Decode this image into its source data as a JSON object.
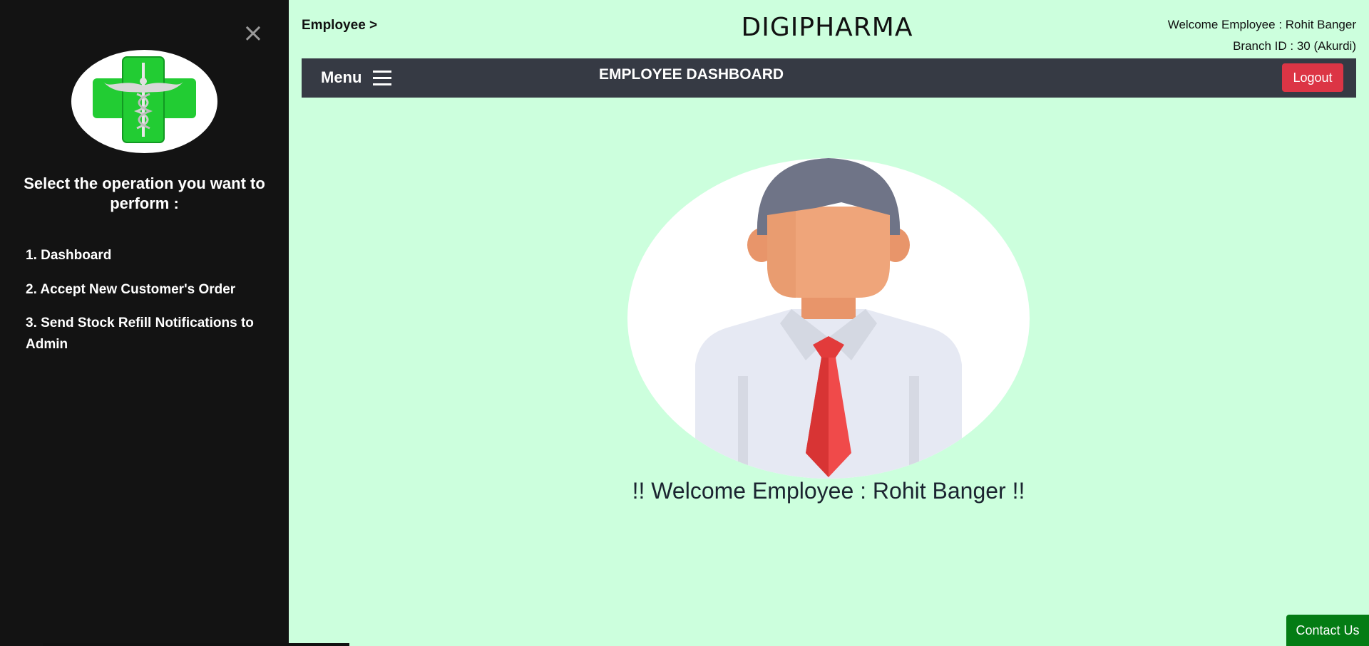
{
  "sidebar": {
    "close_icon": "×",
    "prompt": "Select the operation you want to perform :",
    "operations": [
      "1. Dashboard",
      "2. Accept New Customer's Order",
      "3. Send Stock Refill Notifications to Admin"
    ]
  },
  "header": {
    "breadcrumb": "Employee >",
    "brand": "DIGIPHARMA",
    "welcome": "Welcome Employee : Rohit Banger",
    "branch": "Branch ID : 30 (Akurdi)"
  },
  "navbar": {
    "menu_label": "Menu",
    "title": "EMPLOYEE DASHBOARD",
    "logout_label": "Logout"
  },
  "main": {
    "welcome_message": "!! Welcome Employee : Rohit Banger !!"
  },
  "footer": {
    "contact_label": "Contact Us"
  },
  "colors": {
    "background": "#ccffdd",
    "sidebar": "#131313",
    "navbar": "#363a44",
    "logout": "#dc3545",
    "contact": "#047c14",
    "cross_green": "#22cc33"
  }
}
